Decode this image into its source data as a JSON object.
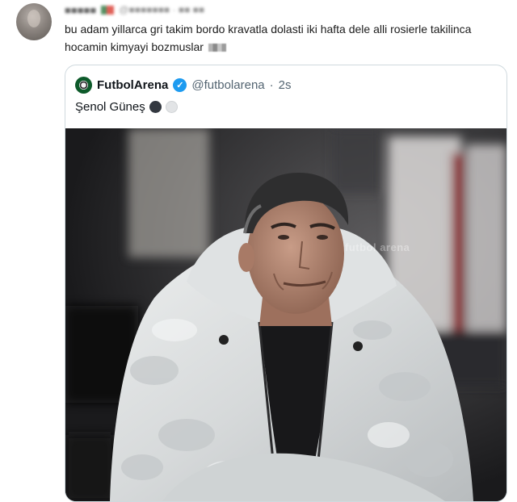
{
  "tweet": {
    "text": "bu adam yillarca gri takim bordo kravatla dolasti iki hafta dele alli rosierle takilinca hocamin kimyayi bozmuslar",
    "name_blurred": "■■■■■",
    "handle_blurred": "@■■■■■■■ · ■■ ■■"
  },
  "quoted": {
    "name": "FutbolArena",
    "handle": "@futbolarena",
    "separator": "·",
    "time": "2s",
    "text": "Şenol Güneş",
    "watermark": "futbol arena"
  },
  "colors": {
    "accent": "#1d9bf0",
    "verified": "#1d9bf0"
  },
  "icons": {
    "verified": "verified-badge-icon",
    "circle_dark": "black-circle-emoji",
    "circle_light": "white-circle-emoji"
  }
}
